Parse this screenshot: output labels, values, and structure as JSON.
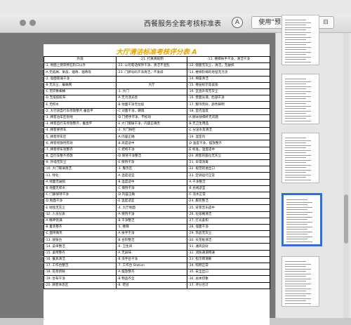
{
  "window": {
    "title": "西餐服务全套考核标准表",
    "open_button": "使用“预览”打开",
    "annotate_glyph": "A",
    "sidebar_glyph": "⊟"
  },
  "document": {
    "title": "大厅清洁标准考核评分表 A",
    "rows": [
      [
        "外观",
        "-21. 打真真眩明",
        "-11. 楼梯扶手干净，清洁干净"
      ],
      [
        "-1. 地面上建筑物石阶口以外",
        "-22. 公司电话保持干净，清洁不混乱",
        "-12. 镜面无灰尘，清洁，无破损"
      ],
      [
        "-A 无纸屑、果皮、烟蒂、烟蒂等",
        "-23. 门牌号码干净清洁，不发斜",
        "-13. 楼梯阶梯的地毯无污渍"
      ],
      [
        "-2. 墙面玻璃干净",
        "",
        "-14. 梯座清洁"
      ],
      [
        "-B 无灰尘、蜘蛛网",
        "大厅",
        "-15. 楼层标示等美丽"
      ],
      [
        "-C 无印象蜘蛛",
        "-1. 大门",
        "-16. 坚直升等无灰尘"
      ],
      [
        "-D 无纸胶胶布",
        "-A 无污渍光亮",
        "-16. 壁面光滑，脸部干净"
      ],
      [
        "-E 无积水",
        "-B 地面干净无垃圾",
        "-17. 服饰完好，颜色鲜明"
      ],
      [
        "-2. 大行道自行车停放整齐 垂直平",
        "-C 对面干净，朝阳",
        "-18. 室内温度"
      ],
      [
        "-3. 顾客泊车区划地",
        "-D 门把手干净，不松动",
        "-A 顾米扶梯杆无问题"
      ],
      [
        "-3. 顾客自行车停放整齐，垂直平",
        "-E 大门玻璃干净，内容正确无",
        "-B 无卫生用品"
      ],
      [
        "-4. 顾客要停车",
        "-2. 大门扶栏",
        "-C 分泌水及清洁"
      ],
      [
        "-5. 顾客停车区",
        "-A 内容正确",
        "-19. 温室内"
      ],
      [
        "-6. 顾客停放时有效",
        "-B 高度适中",
        "-D 温度干净，摆放整齐"
      ],
      [
        "-7. 顾客停车等整齐",
        "-C 结构干净",
        "-E 标准，温度适中"
      ],
      [
        "-8. 自行车整齐停放",
        "-D 保持干净整洁",
        "-20. 顾客的座位无灰尘"
      ],
      [
        "-9. 外墙无灰尘",
        "-E 保持干净",
        "-21. 日常消毒"
      ],
      [
        "-10. 大门玻璃清洁",
        "-3. 服务区",
        "-22. 规范的进出口"
      ],
      [
        "-11. 绿化",
        "-A 温度适宜",
        "-23. 空调运行正常"
      ],
      [
        "-A 地面无破损",
        "-B 温度适中",
        "-A 干净整洁"
      ],
      [
        "-B 地面无积水",
        "-C 保持干净",
        "-B 光线适宜"
      ],
      [
        "-C 门廊保持干净",
        "-D 内容正确",
        "-C 流水正常"
      ],
      [
        "-D 地面干净",
        "-E 温度适宜",
        "-24. 服装整洁"
      ],
      [
        "-E 地毯无灰尘",
        "-4. 大厅地面",
        "-25. 背景音乐适中"
      ],
      [
        "-12. 人员仪表",
        "-A 保持干净",
        "-26. 垃圾桶清洁"
      ],
      [
        "-A 精神饱满",
        "-B 干净整洁",
        "-27. 灯光柔和"
      ],
      [
        "-B 着装整齐",
        "-5. 楼梯",
        "-28. 墙面干净"
      ],
      [
        "-C 面带微笑",
        "-A 扶手干净",
        "-29. 饰品无灰尘"
      ],
      [
        "-13. 收银台",
        "-B 台阶整洁",
        "-30. 天花板清洁"
      ],
      [
        "-14. 菜单整洁",
        "-6. 卫生间",
        "-31. 通风良好"
      ],
      [
        "-15. 桌椅整齐",
        "-A 无异味",
        "-32. 消防通道畅通"
      ],
      [
        "-16. 餐具清洁",
        "-B 洗手台干净",
        "-33. 指示牌清晰"
      ],
      [
        "-17. 工作台整洁",
        "-7. 工作台 Station",
        "-34. 照明正常"
      ],
      [
        "-18. 花草新鲜",
        "-A 摆放整齐",
        "-35. 安全出口"
      ],
      [
        "-19. 台布干净",
        "-B 物品齐全",
        "-36. 总体印象"
      ],
      [
        "-20. 顾客休息区",
        "-8. 吧台",
        "-37. 评分合计"
      ]
    ]
  },
  "sidebar": {
    "thumb_count": 5,
    "selected_index": 3
  }
}
